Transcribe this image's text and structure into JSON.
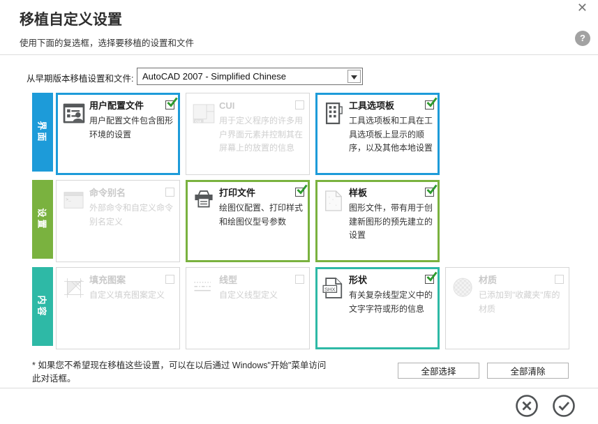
{
  "window": {
    "close_icon": "✕"
  },
  "header": {
    "title": "移植自定义设置",
    "subtitle": "使用下面的复选框，选择要移植的设置和文件",
    "help_icon": "?"
  },
  "migrate_from": {
    "label": "从早期版本移植设置和文件:",
    "selected_option": "AutoCAD 2007 - Simplified Chinese"
  },
  "colors": {
    "interface_blue": "#1d9bd9",
    "settings_green": "#7ab23f",
    "content_teal": "#2eb9a6",
    "check_green": "#2e9b2e"
  },
  "rows": [
    {
      "label": "界面",
      "cards": [
        {
          "title": "用户配置文件",
          "desc": "用户配置文件包含图形环境的设置",
          "checked": true,
          "icon": "user-profile-icon"
        },
        {
          "title": "CUI",
          "desc": "用于定义程序的许多用户界面元素并控制其在屏幕上的放置的信息",
          "checked": false,
          "icon": "cui-icon"
        },
        {
          "title": "工具选项板",
          "desc": "工具选项板和工具在工具选项板上显示的顺序，以及其他本地设置",
          "checked": true,
          "icon": "tool-palettes-icon"
        }
      ]
    },
    {
      "label": "设置",
      "cards": [
        {
          "title": "命令别名",
          "desc": "外部命令和自定义命令别名定义",
          "checked": false,
          "icon": "command-alias-icon"
        },
        {
          "title": "打印文件",
          "desc": "绘图仪配置、打印样式和绘图仪型号参数",
          "checked": true,
          "icon": "printer-icon"
        },
        {
          "title": "样板",
          "desc": "图形文件，带有用于创建新图形的预先建立的设置",
          "checked": true,
          "icon": "template-file-icon"
        }
      ]
    },
    {
      "label": "内容",
      "cards": [
        {
          "title": "填充图案",
          "desc": "自定义填充图案定义",
          "checked": false,
          "icon": "hatch-pattern-icon"
        },
        {
          "title": "线型",
          "desc": "自定义线型定义",
          "checked": false,
          "icon": "linetype-icon"
        },
        {
          "title": "形状",
          "desc": "有关复杂线型定义中的文字字符或形的信息",
          "checked": true,
          "icon": "shx-shape-icon"
        },
        {
          "title": "材质",
          "desc": "已添加到\"收藏夹\"库的材质",
          "checked": false,
          "icon": "material-sphere-icon"
        }
      ]
    }
  ],
  "footer": {
    "note": "* 如果您不希望现在移植这些设置，可以在以后通过 Windows\"开始\"菜单访问此对话框。",
    "select_all_label": "全部选择",
    "clear_all_label": "全部清除"
  }
}
